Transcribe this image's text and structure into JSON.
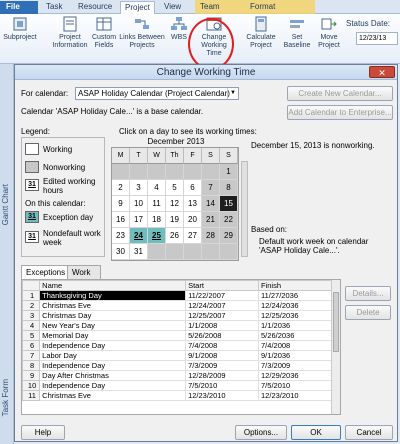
{
  "ribbon": {
    "tabs": [
      "File",
      "Task",
      "Resource",
      "Project",
      "View",
      "Team",
      "Format"
    ],
    "buttons": [
      {
        "label": "Subproject",
        "icon": "subproject-icon"
      },
      {
        "label": "Project Information",
        "icon": "info-icon"
      },
      {
        "label": "Custom Fields",
        "icon": "fields-icon"
      },
      {
        "label": "Links Between Projects",
        "icon": "links-icon"
      },
      {
        "label": "WBS",
        "icon": "wbs-icon"
      },
      {
        "label": "Change Working Time",
        "icon": "calendar-icon"
      },
      {
        "label": "Calculate Project",
        "icon": "calculate-icon"
      },
      {
        "label": "Set Baseline",
        "icon": "baseline-icon"
      },
      {
        "label": "Move Project",
        "icon": "move-icon"
      }
    ],
    "status_date_label": "Status Date:",
    "status_date_value": "12/23/13"
  },
  "left_strip": {
    "view1": "Gantt Chart",
    "view2": "Task Form"
  },
  "dialog": {
    "title": "Change Working Time",
    "for_calendar_label": "For calendar:",
    "calendar_value": "ASAP Holiday Calendar (Project Calendar)",
    "base_note": "Calendar 'ASAP Holiday Cale...' is a base calendar.",
    "create_new_btn": "Create New Calendar...",
    "add_enterprise_btn": "Add Calendar to Enterprise...",
    "legend_title": "Legend:",
    "legend": {
      "working": "Working",
      "nonworking": "Nonworking",
      "edited": "Edited working hours",
      "edited_num": "31",
      "on_this": "On this calendar:",
      "exception": "Exception day",
      "exception_num": "31",
      "nondefault": "Nondefault work week",
      "nondefault_num": "31"
    },
    "click_hint": "Click on a day to see its working times:",
    "calendar_month": "December 2013",
    "day_headers": [
      "M",
      "T",
      "W",
      "Th",
      "F",
      "S",
      "S"
    ],
    "info_text": "December 15, 2013 is nonworking.",
    "based_on": "Based on:",
    "based_detail": "Default work week on calendar 'ASAP Holiday Cale...'.",
    "tab_exceptions": "Exceptions",
    "tab_work_weeks": "Work Weeks",
    "columns": [
      "Name",
      "Start",
      "Finish"
    ],
    "rows": [
      {
        "n": "1",
        "name": "Thanksgiving Day",
        "start": "11/22/2007",
        "finish": "11/27/2036"
      },
      {
        "n": "2",
        "name": "Christmas Eve",
        "start": "12/24/2007",
        "finish": "12/24/2036"
      },
      {
        "n": "3",
        "name": "Christmas Day",
        "start": "12/25/2007",
        "finish": "12/25/2036"
      },
      {
        "n": "4",
        "name": "New Year's Day",
        "start": "1/1/2008",
        "finish": "1/1/2036"
      },
      {
        "n": "5",
        "name": "Memorial Day",
        "start": "5/26/2008",
        "finish": "5/26/2036"
      },
      {
        "n": "6",
        "name": "Independence Day",
        "start": "7/4/2008",
        "finish": "7/4/2008"
      },
      {
        "n": "7",
        "name": "Labor Day",
        "start": "9/1/2008",
        "finish": "9/1/2036"
      },
      {
        "n": "8",
        "name": "Independence Day",
        "start": "7/3/2009",
        "finish": "7/3/2009"
      },
      {
        "n": "9",
        "name": "Day After Christmas",
        "start": "12/28/2009",
        "finish": "12/29/2036"
      },
      {
        "n": "10",
        "name": "Independence Day",
        "start": "7/5/2010",
        "finish": "7/5/2010"
      },
      {
        "n": "11",
        "name": "Christmas Eve",
        "start": "12/23/2010",
        "finish": "12/23/2010"
      }
    ],
    "details_btn": "Details...",
    "delete_btn": "Delete",
    "help_btn": "Help",
    "options_btn": "Options...",
    "ok_btn": "OK",
    "cancel_btn": "Cancel",
    "close_glyph": "✕"
  },
  "colors": {
    "exception": "#6fbdbd",
    "selected_day": "#1e1e1e",
    "nonworking": "#c8c8c8",
    "annotation": "#e02020"
  }
}
